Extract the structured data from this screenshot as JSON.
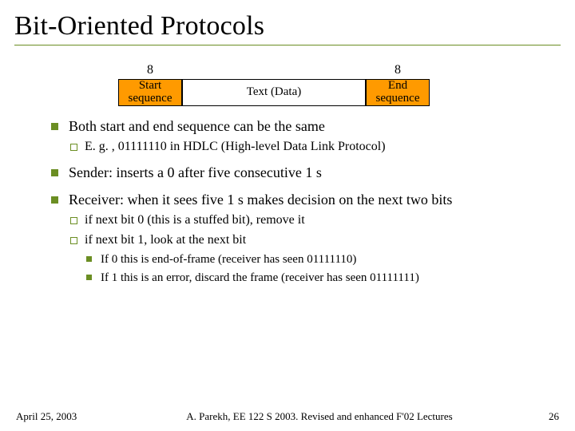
{
  "title": "Bit-Oriented Protocols",
  "diagram": {
    "left_label": "8",
    "right_label": "8",
    "start_box": "Start sequence",
    "data_box": "Text (Data)",
    "end_box": "End sequence"
  },
  "bullets": {
    "b1": "Both start and end sequence can be the same",
    "b1a": "E. g. , 01111110 in HDLC (High-level Data Link Protocol)",
    "b2": "Sender: inserts a 0 after five consecutive 1 s",
    "b3": "Receiver: when it sees five 1 s makes decision on the next two bits",
    "b3a": "if next bit 0 (this is a stuffed bit), remove it",
    "b3b": "if next bit 1, look at the next bit",
    "b3b1": "If 0 this is end-of-frame (receiver has seen 01111110)",
    "b3b2": "If 1 this is an error, discard the frame (receiver has seen 01111111)"
  },
  "footer": {
    "date": "April 25, 2003",
    "center": "A. Parekh, EE 122 S 2003. Revised and enhanced  F'02 Lectures",
    "page": "26"
  }
}
